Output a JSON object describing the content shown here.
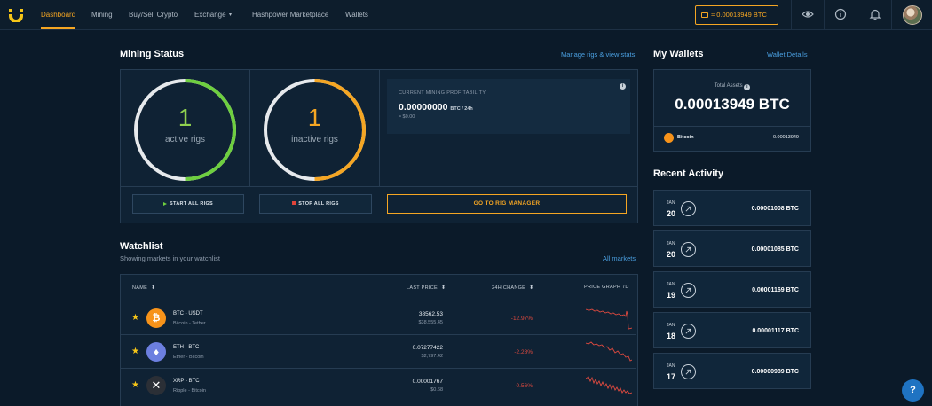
{
  "nav": {
    "items": [
      "Dashboard",
      "Mining",
      "Buy/Sell Crypto",
      "Exchange",
      "Hashpower Marketplace",
      "Wallets"
    ],
    "balance_button": "≈ 0.00013949 BTC"
  },
  "mining_status": {
    "title": "Mining Status",
    "manage_link": "Manage rigs & view stats",
    "active_count": "1",
    "active_label": "active rigs",
    "inactive_count": "1",
    "inactive_label": "inactive rigs",
    "profit_caption": "CURRENT MINING PROFITABILITY",
    "profit_value": "0.00000000",
    "profit_unit": "BTC / 24h",
    "profit_usd": "≈ $0.00",
    "start_button": "START ALL RIGS",
    "stop_button": "STOP ALL RIGS",
    "rig_manager_button": "GO TO RIG MANAGER"
  },
  "watchlist": {
    "title": "Watchlist",
    "subtitle": "Showing markets in your watchlist",
    "all_markets_link": "All markets",
    "columns": {
      "name": "NAME",
      "last_price": "LAST PRICE",
      "change": "24H CHANGE",
      "graph": "PRICE GRAPH 7D"
    },
    "rows": [
      {
        "pair": "BTC - USDT",
        "name": "Bitcoin - Tether",
        "price": "38562.53",
        "price_usd": "$38,555.45",
        "change": "-12.97%"
      },
      {
        "pair": "ETH - BTC",
        "name": "Ether - Bitcoin",
        "price": "0.07277422",
        "price_usd": "$2,797.42",
        "change": "-2.28%"
      },
      {
        "pair": "XRP - BTC",
        "name": "Ripple - Bitcoin",
        "price": "0.00001767",
        "price_usd": "$0.68",
        "change": "-0.56%"
      }
    ]
  },
  "wallets": {
    "title": "My Wallets",
    "details_link": "Wallet Details",
    "total_caption": "Total Assets",
    "total_value": "0.00013949 BTC",
    "coin_name": "Bitcoin",
    "coin_amount": "0.00013949"
  },
  "activity": {
    "title": "Recent Activity",
    "items": [
      {
        "month": "JAN",
        "day": "20",
        "amount": "0.00001008 BTC"
      },
      {
        "month": "JAN",
        "day": "20",
        "amount": "0.00001085 BTC"
      },
      {
        "month": "JAN",
        "day": "19",
        "amount": "0.00001169 BTC"
      },
      {
        "month": "JAN",
        "day": "18",
        "amount": "0.00001117 BTC"
      },
      {
        "month": "JAN",
        "day": "17",
        "amount": "0.00000989 BTC"
      }
    ]
  },
  "help_label": "?",
  "colors": {
    "accent": "#f5a623",
    "active": "#6ecf3f",
    "negative": "#e04a3f",
    "link": "#4a9fe0"
  }
}
